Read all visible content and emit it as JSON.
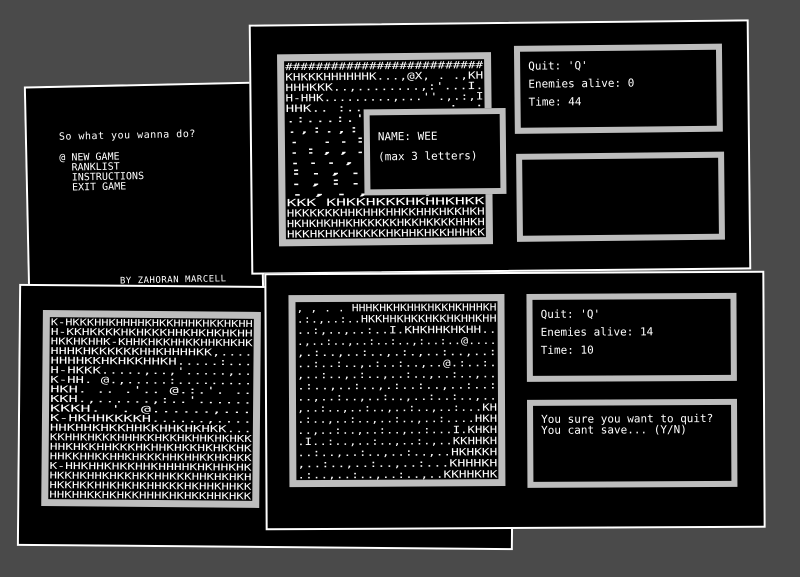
{
  "menu": {
    "prompt": "So what you wanna do?",
    "cursor": "@",
    "items": [
      "NEW GAME",
      "RANKLIST",
      "INSTRUCTIONS",
      "EXIT GAME"
    ],
    "credit": "BY ZAHORAN MARCELL"
  },
  "top_game": {
    "map_rows": [
      "##########################",
      "KHKKKHHHHHHK...,@X, .  .,KH",
      "HHHKKK..,........,:'...I.",
      "H-HHK.........,...''.,.:,I",
      "HHK..  :......,.,..  :..:",
      ".:...:.',:..........",
      ".,:.,:..:.......",
      ". ..:.,.....",
      ".:,,....,:..",
      "...,.,'....",
      ":.,.......",
      ".,:.,.,...",
      ".,.,'.,..",
      "KKK        KHKKHKKKHKHHKHKK",
      "HKKKKKKHHKHHKHHKKHHKHKKHKH",
      "HKHKHKHHKHKKKKKHKKHKKKKHHKH",
      "HKKHKHKKHKKKKHKHHKHKKHHHKK"
    ],
    "name_dialog": {
      "line1": "NAME: WEE",
      "line2": "(max 3 letters)"
    },
    "status": {
      "quit": "Quit: 'Q'",
      "enemies": "Enemies alive: 0",
      "time": "Time: 44"
    },
    "message": ""
  },
  "bottom_left_map": {
    "map_rows": [
      "K-HKKKHHKHHHHKHKKHHHKHKKHKHH",
      "H-KKHKKKKHKHKKKHHKHKHKHKHH",
      "HKKHKHHK-KHHKHKKHHKKHHKHKHK",
      "HHHKHKKKKKKHHKHHHHKK,....",
      "HHHHKKHKHKKHHKH.....:...",
      "H-HKKK.....,..,'.....,..",
      "K-HH. @.,.....:.........",
      "HKH. .. .'.. @.:.'. ..",
      "KKH.,......,:..'......",
      "KKKH.  '. @......,...",
      "K-HKHHKKKKH......,....",
      "HHKHHKHKKHHKKHHKHKHKK...",
      "KKHHKHKKKHHHKKHKKHKHHKHKHKK",
      "HHKHKKHHKKKHKHHKHKKHKHKKHK",
      "HHKKHHKKHHKHKKKHHKHHKKHKHKK",
      "K-HHKHHKHKKHHKHHHHKHKHHKHK",
      "HKKHKHHKHKKHKKHHKKKHHKHKHKH",
      "HKKHKKHHKHKHKHHKKKHKHHKHHKK",
      "HHKHHKKHKHKKHHHKHKHKKHHKHKK"
    ]
  },
  "bottom_game": {
    "map_rows": [
      ", , . . HHHKHKHKHHKHKKHKHHHKH",
      ".:.,..:..HKKHHKHKKHKKHKHHKHH",
      "..:,..,..:..I.KHKHHKHKHH..",
      ".,..:..,..:..:..,:..:..@....",
      ",.:..,..:..,.:.,..:..,..:",
      "..:..:..,.:..:..,..@.:..:.",
      ",..:..,.:..,..:..,..:..,..",
      ".:..,..:..,.:..:..,..:..:",
      "..,..:..,..:..,..:..:..,..",
      ",..:..,..:..,..:..,..:...KH",
      ".:..,..:..,..:..,..:....HKH",
      "..,..:..,..:..,..:...I.KHKH",
      ".I..:..,..:..,..:.,..KKHHKH",
      "..:..,..:..,..:..,..HKHKKH",
      ",..:..,..:..,..:...KHHHKH",
      ".:..,..:..,..:..,..KKHHKHK"
    ],
    "status": {
      "quit": "Quit: 'Q'",
      "enemies": "Enemies alive: 14",
      "time": "Time: 10"
    },
    "message": "You sure you want to quit? You cant save... (Y/N)"
  }
}
